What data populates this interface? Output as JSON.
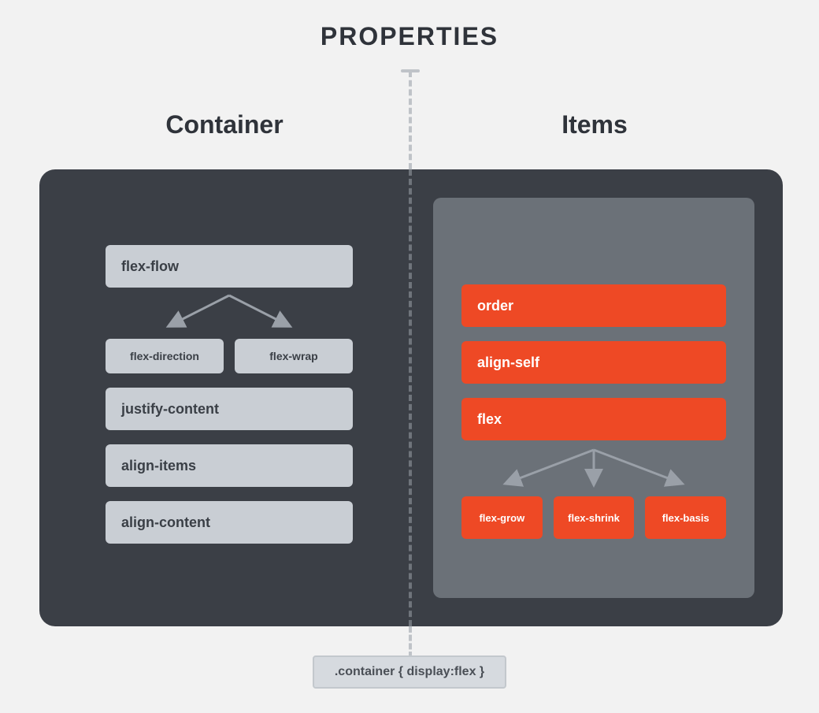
{
  "title": "PROPERTIES",
  "headers": {
    "left": "Container",
    "right": "Items"
  },
  "container": {
    "top": "flex-flow",
    "sub": [
      "flex-direction",
      "flex-wrap"
    ],
    "rest": [
      "justify-content",
      "align-items",
      "align-content"
    ]
  },
  "items": {
    "rest": [
      "order",
      "align-self"
    ],
    "top": "flex",
    "sub": [
      "flex-grow",
      "flex-shrink",
      "flex-basis"
    ]
  },
  "caption": ".container { display:flex }"
}
